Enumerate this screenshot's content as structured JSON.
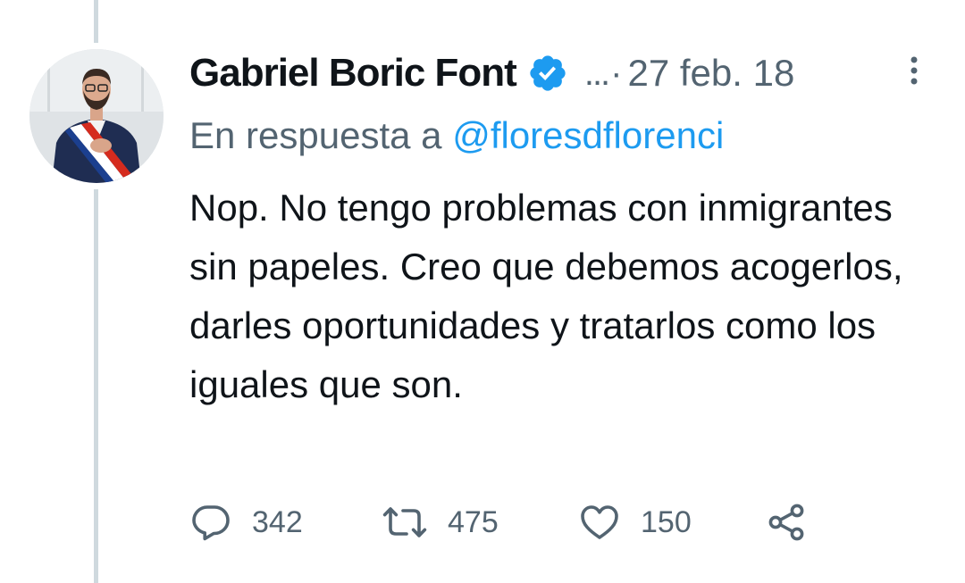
{
  "tweet": {
    "author_name": "Gabriel Boric Font",
    "ellipsis": "...",
    "separator": "·",
    "date": "27 feb. 18",
    "reply_prefix": "En respuesta a ",
    "reply_mention": "@floresdflorenci",
    "text": "Nop. No tengo problemas con inmigrantes sin papeles. Creo que debemos acogerlos, darles oportunidades y tratarlos como los iguales que son.",
    "verified": true
  },
  "actions": {
    "reply_count": "342",
    "retweet_count": "475",
    "like_count": "150"
  },
  "icons": {
    "reply": "speech-bubble-icon",
    "retweet": "retweet-arrows-icon",
    "like": "heart-outline-icon",
    "share": "share-nodes-icon",
    "more": "vertical-dots-icon",
    "verified": "verified-badge-icon"
  },
  "colors": {
    "text_primary": "#0f1419",
    "text_secondary": "#536471",
    "accent": "#1d9bf0",
    "thread_line": "#cfd9de"
  }
}
